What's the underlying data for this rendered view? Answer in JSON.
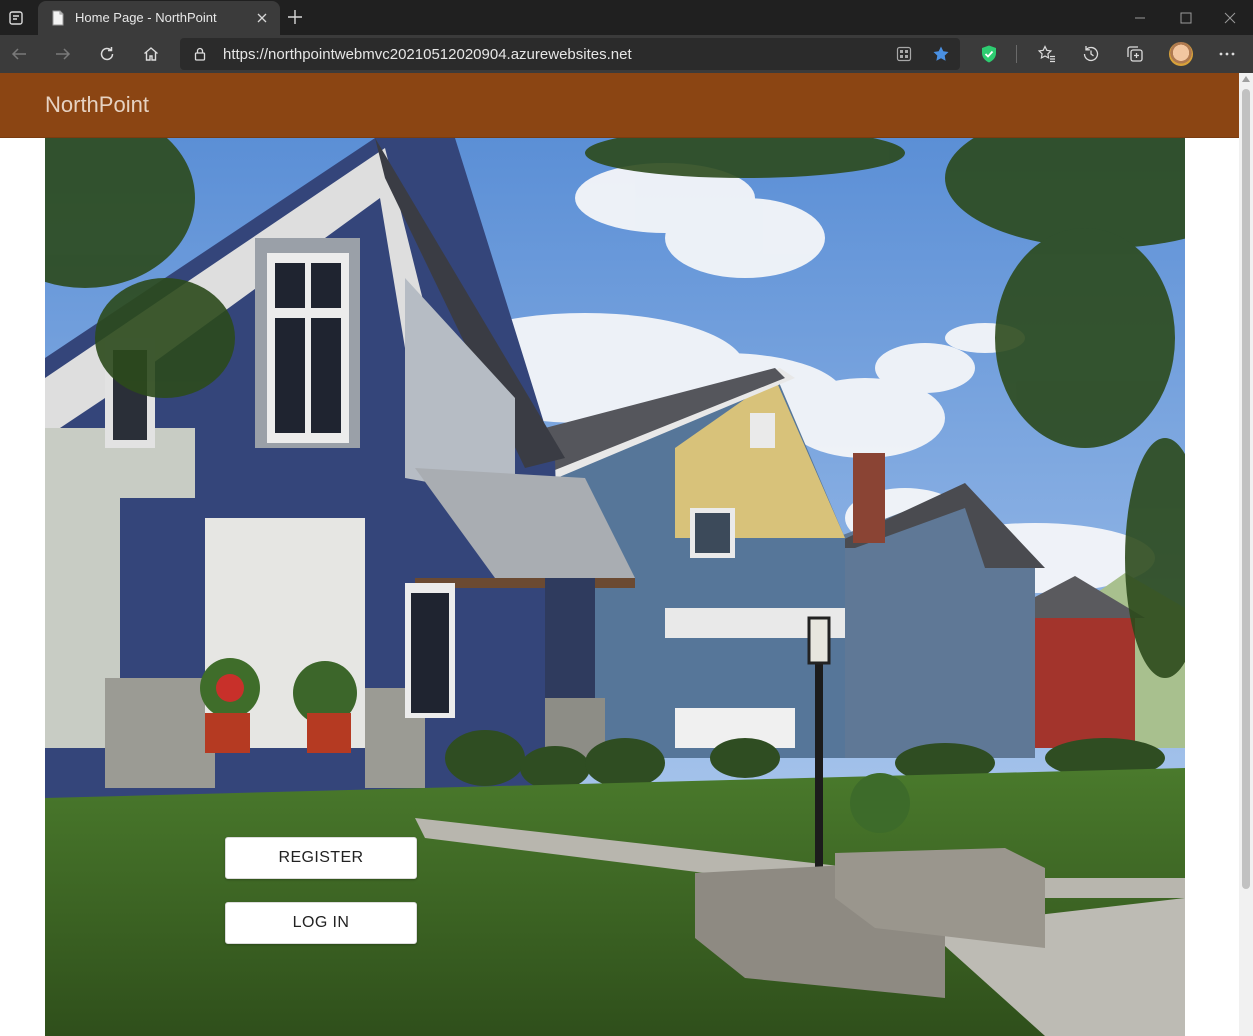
{
  "browser": {
    "tab_title": "Home Page - NorthPoint",
    "url": "https://northpointwebmvc20210512020904.azurewebsites.net",
    "accent_color": "#4a90e2",
    "shield_color": "#2ecc71"
  },
  "navbar": {
    "brand": "NorthPoint",
    "background_color": "#8b4513"
  },
  "hero": {
    "image": "house-row-photo",
    "buttons": {
      "register": "REGISTER",
      "login": "LOG IN"
    }
  }
}
